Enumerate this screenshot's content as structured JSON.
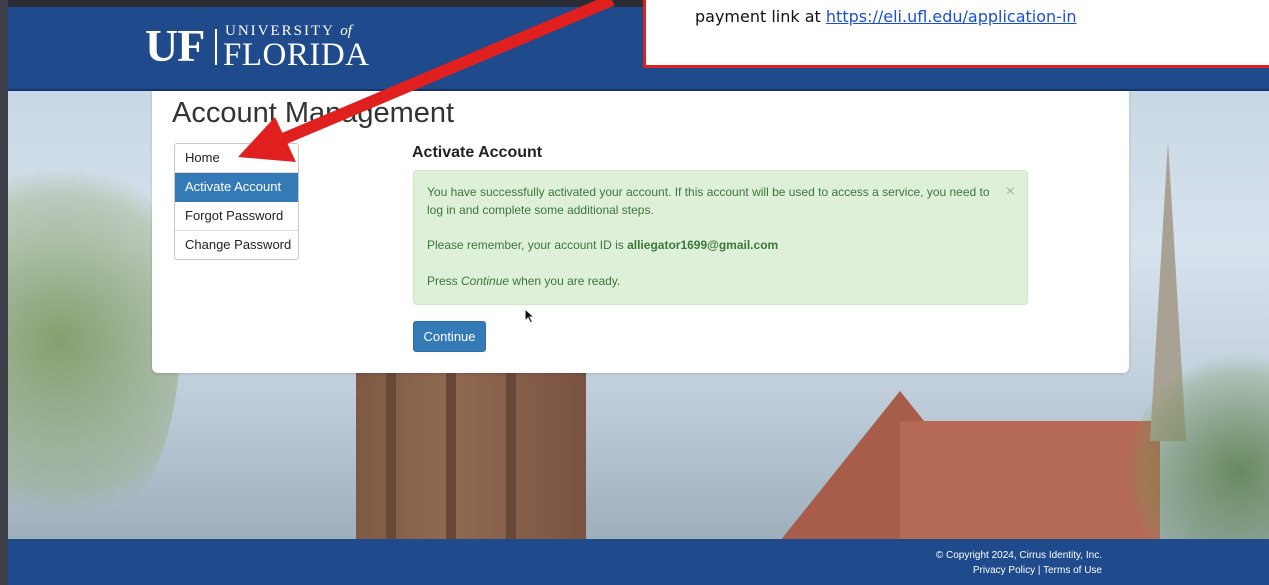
{
  "header": {
    "logo_uf": "UF",
    "logo_university": "UNIVERSITY",
    "logo_of": "of",
    "logo_florida": "FLORIDA"
  },
  "callout": {
    "text_prefix": "payment link at ",
    "link_text": "https://eli.ufl.edu/application-in",
    "border_color": "#e01f1f"
  },
  "page": {
    "title": "Account Management"
  },
  "nav": {
    "items": [
      {
        "label": "Home",
        "active": false
      },
      {
        "label": "Activate Account",
        "active": true
      },
      {
        "label": "Forgot Password",
        "active": false
      },
      {
        "label": "Change Password",
        "active": false
      }
    ]
  },
  "main": {
    "section_title": "Activate Account",
    "alert": {
      "line1": "You have successfully activated your account. If this account will be used to access a service, you need to log in and complete some additional steps.",
      "line2_prefix": "Please remember, your account ID is ",
      "account_id": "alliegator1699@gmail.com",
      "line3_prefix": "Press ",
      "line3_emph": "Continue",
      "line3_suffix": " when you are ready.",
      "close_symbol": "×"
    },
    "continue_label": "Continue"
  },
  "footer": {
    "copyright": "© Copyright 2024, Cirrus Identity, Inc.",
    "privacy": "Privacy Policy",
    "separator": "|",
    "terms": "Terms of Use"
  },
  "colors": {
    "header_bg": "#1f4a8c",
    "primary": "#337ab7",
    "alert_bg": "#dff0d8",
    "alert_text": "#3c763d",
    "annotation_red": "#e01f1f"
  }
}
